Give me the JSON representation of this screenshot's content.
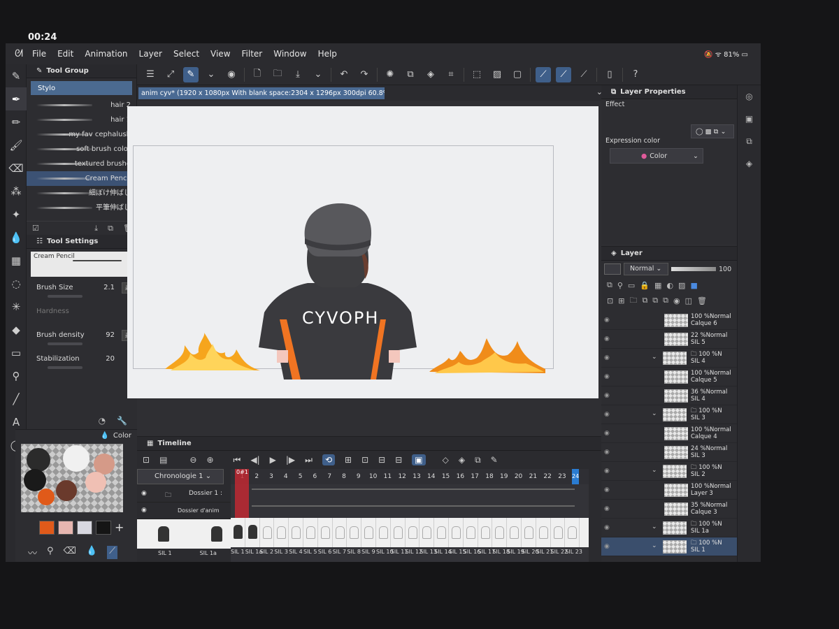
{
  "status": {
    "time": "00:24",
    "battery": "81%"
  },
  "menu": [
    "File",
    "Edit",
    "Animation",
    "Layer",
    "Select",
    "View",
    "Filter",
    "Window",
    "Help"
  ],
  "document": {
    "title": "anim cyv* (1920 x 1080px With blank space:2304 x 1296px 300dpi 60.8%)"
  },
  "tool_group": {
    "title": "Tool Group",
    "current": "Stylo",
    "brushes": [
      "hair 2",
      "hair 1",
      "my fav cephalush",
      "soft brush color",
      "textured brushe",
      "Cream Pencil",
      "細ぼけ伸ばし",
      "平筆伸ばし"
    ],
    "selected_index": 5
  },
  "tool_settings": {
    "title": "Tool Settings",
    "preset": "Cream Pencil",
    "brush_size_label": "Brush Size",
    "brush_size": "2.1",
    "hardness_label": "Hardness",
    "density_label": "Brush density",
    "density": "92",
    "stabilization_label": "Stabilization",
    "stabilization": "20"
  },
  "color_panel": {
    "title": "Color",
    "swatches": [
      "#e05a1a",
      "#e6b6b0",
      "#d8d8e0",
      "#151515"
    ],
    "palette_blobs": [
      "#2b2b2b",
      "#f0f0f0",
      "#d59a88",
      "#1a1a1a",
      "#f0c0b4",
      "#6a3a2c",
      "#e05a1a"
    ]
  },
  "layer_properties": {
    "title": "Layer Properties",
    "effect_label": "Effect",
    "expression_label": "Expression color",
    "expression_value": "Color"
  },
  "layer_panel": {
    "title": "Layer",
    "blend": "Normal",
    "opacity": "100",
    "layers": [
      {
        "pct": "100 %Normal",
        "name": "Calque 6",
        "folder": false
      },
      {
        "pct": "22 %Normal",
        "name": "SIL 5",
        "folder": false
      },
      {
        "pct": "100 %N",
        "name": "SIL 4",
        "folder": true
      },
      {
        "pct": "100 %Normal",
        "name": "Calque 5",
        "folder": false
      },
      {
        "pct": "36 %Normal",
        "name": "SIL 4",
        "folder": false
      },
      {
        "pct": "100 %N",
        "name": "SIL 3",
        "folder": true
      },
      {
        "pct": "100 %Normal",
        "name": "Calque 4",
        "folder": false
      },
      {
        "pct": "24 %Normal",
        "name": "SIL 3",
        "folder": false
      },
      {
        "pct": "100 %N",
        "name": "SIL 2",
        "folder": true
      },
      {
        "pct": "100 %Normal",
        "name": "Layer 3",
        "folder": false
      },
      {
        "pct": "35 %Normal",
        "name": "Calque 3",
        "folder": false
      },
      {
        "pct": "100 %N",
        "name": "SIL 1a",
        "folder": true
      },
      {
        "pct": "100 %N",
        "name": "SIL 1",
        "folder": true
      }
    ]
  },
  "timeline": {
    "title": "Timeline",
    "chronology": "Chronologie 1",
    "track1": "Dossier 1 :",
    "track2": "Dossier d'anim",
    "current_frame": "0#1",
    "end_frame": "24",
    "frames": [
      "1",
      "2",
      "3",
      "4",
      "5",
      "6",
      "7",
      "8",
      "9",
      "10",
      "11",
      "12",
      "13",
      "14",
      "15",
      "16",
      "17",
      "18",
      "19",
      "20",
      "21",
      "22",
      "23"
    ],
    "thumbs": [
      "SIL 1",
      "SIL 1a"
    ],
    "cell_names": [
      "SIL 1",
      "SIL 1a",
      "SIL 2",
      "SIL 3",
      "SIL 4",
      "SIL 5",
      "SIL 6",
      "SIL 7",
      "SIL 8",
      "SIL 9",
      "SIL 10",
      "SIL 11",
      "SIL 12",
      "SIL 13",
      "SIL 14",
      "SIL 15",
      "SIL 16",
      "SIL 17",
      "SIL 18",
      "SIL 19",
      "SIL 20",
      "SIL 21",
      "SIL 22",
      "SIL 23"
    ]
  },
  "artwork": {
    "shirt_text": "CYVOPH"
  }
}
